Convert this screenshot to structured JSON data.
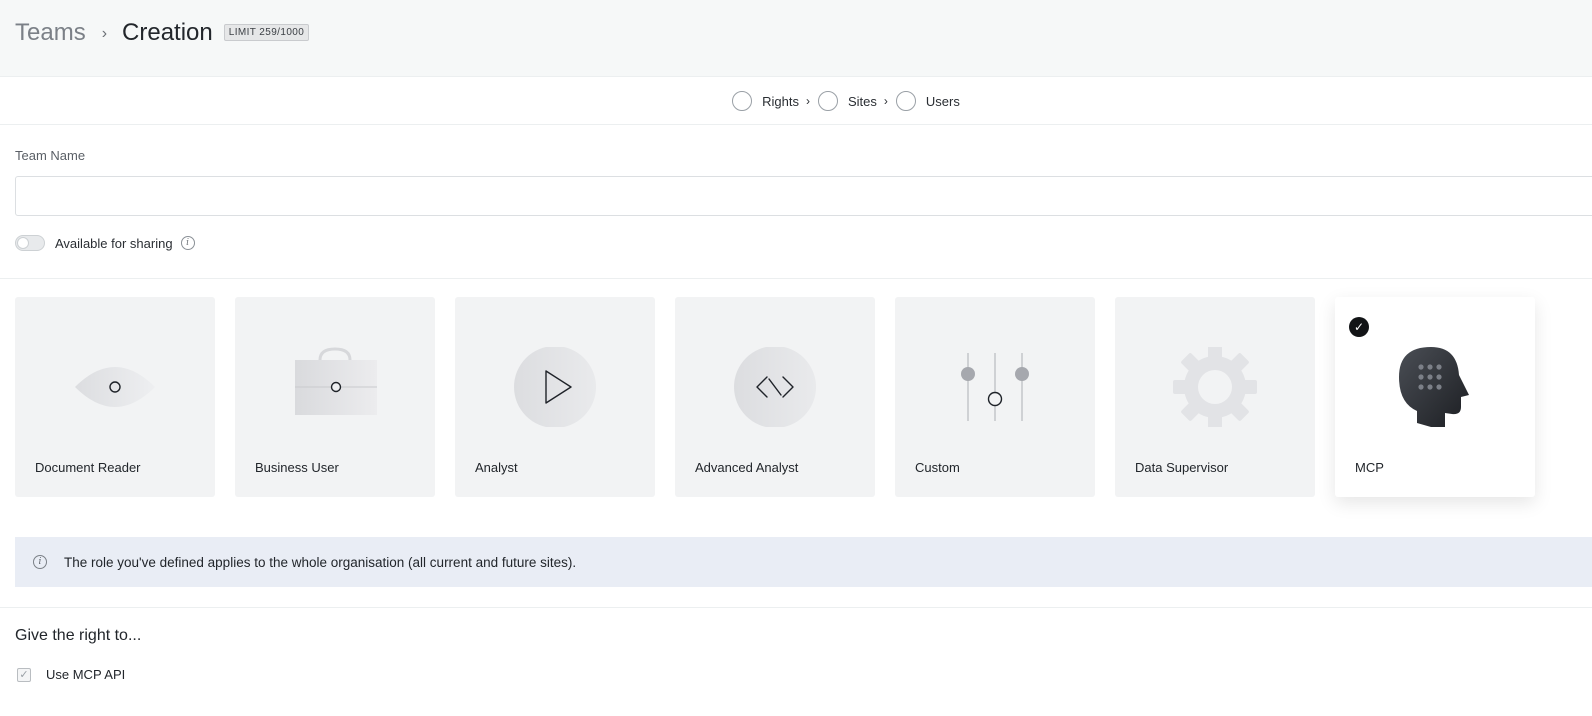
{
  "header": {
    "breadcrumb_parent": "Teams",
    "breadcrumb_separator": "›",
    "breadcrumb_current": "Creation",
    "limit_badge": "LIMIT 259/1000"
  },
  "stepper": {
    "steps": [
      {
        "label": "Rights"
      },
      {
        "label": "Sites"
      },
      {
        "label": "Users"
      }
    ],
    "chevron": "›"
  },
  "form": {
    "team_name_label": "Team Name",
    "team_name_value": "",
    "sharing_label": "Available for sharing",
    "sharing_enabled": false
  },
  "roles": [
    {
      "label": "Document Reader",
      "icon": "eye-icon",
      "selected": false
    },
    {
      "label": "Business User",
      "icon": "briefcase-icon",
      "selected": false
    },
    {
      "label": "Analyst",
      "icon": "play-icon",
      "selected": false
    },
    {
      "label": "Advanced Analyst",
      "icon": "code-icon",
      "selected": false
    },
    {
      "label": "Custom",
      "icon": "sliders-icon",
      "selected": false
    },
    {
      "label": "Data Supervisor",
      "icon": "gear-icon",
      "selected": false
    },
    {
      "label": "MCP",
      "icon": "head-icon",
      "selected": true
    }
  ],
  "info_banner": {
    "text": "The role you've defined applies to the whole organisation (all current and future sites)."
  },
  "rights": {
    "heading": "Give the right to...",
    "items": [
      {
        "label": "Use MCP API",
        "checked": true,
        "disabled": true
      }
    ]
  },
  "colors": {
    "header_bg": "#f6f8f8",
    "card_bg": "#f2f3f4",
    "banner_bg": "#e9edf5",
    "selected_check": "#121416"
  }
}
